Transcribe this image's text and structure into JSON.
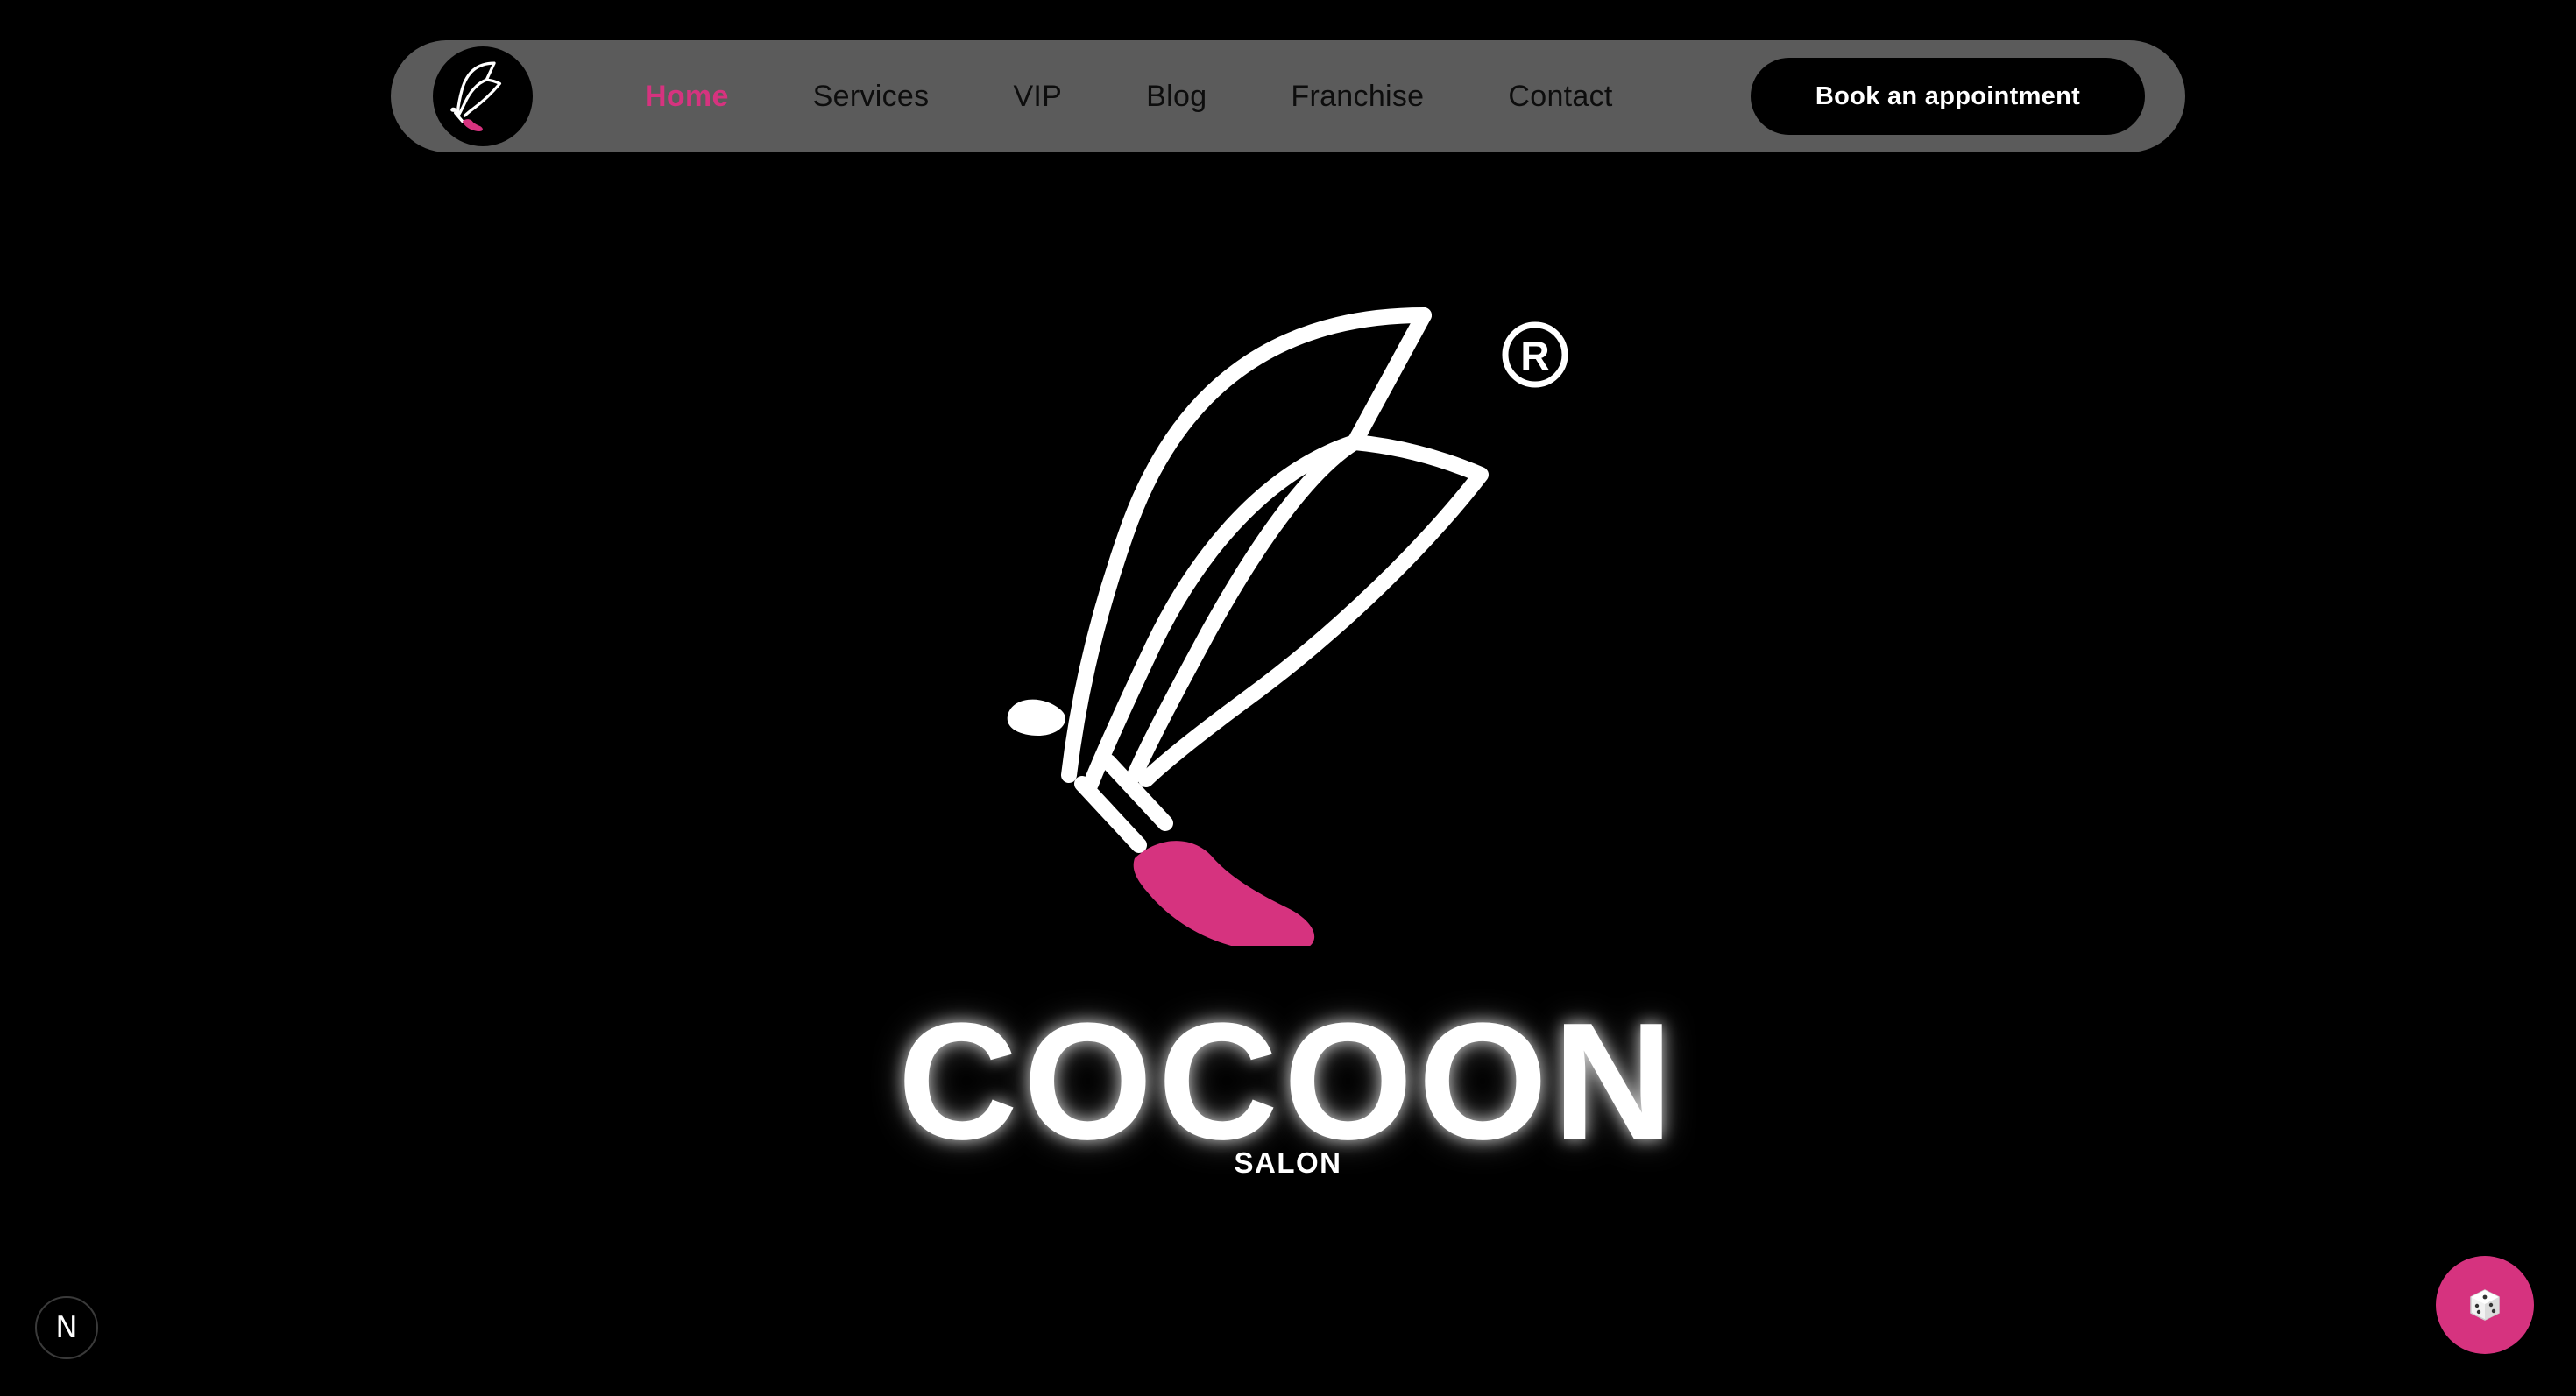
{
  "nav": {
    "items": [
      {
        "label": "Home",
        "active": true
      },
      {
        "label": "Services",
        "active": false
      },
      {
        "label": "VIP",
        "active": false
      },
      {
        "label": "Blog",
        "active": false
      },
      {
        "label": "Franchise",
        "active": false
      },
      {
        "label": "Contact",
        "active": false
      }
    ],
    "cta_label": "Book an appointment",
    "logo_icon": "butterfly-logo-icon"
  },
  "hero": {
    "brand_name": "COCOON",
    "brand_sub": "SALON",
    "logo_icon": "butterfly-logo-icon",
    "registered_mark": "®"
  },
  "widgets": {
    "framework_badge": "N",
    "framework_icon": "nextjs-icon",
    "random_icon": "dice-icon"
  },
  "colors": {
    "accent": "#d6337f",
    "background": "#000000",
    "navbar": "#5b5b5b",
    "text_light": "#ffffff"
  }
}
